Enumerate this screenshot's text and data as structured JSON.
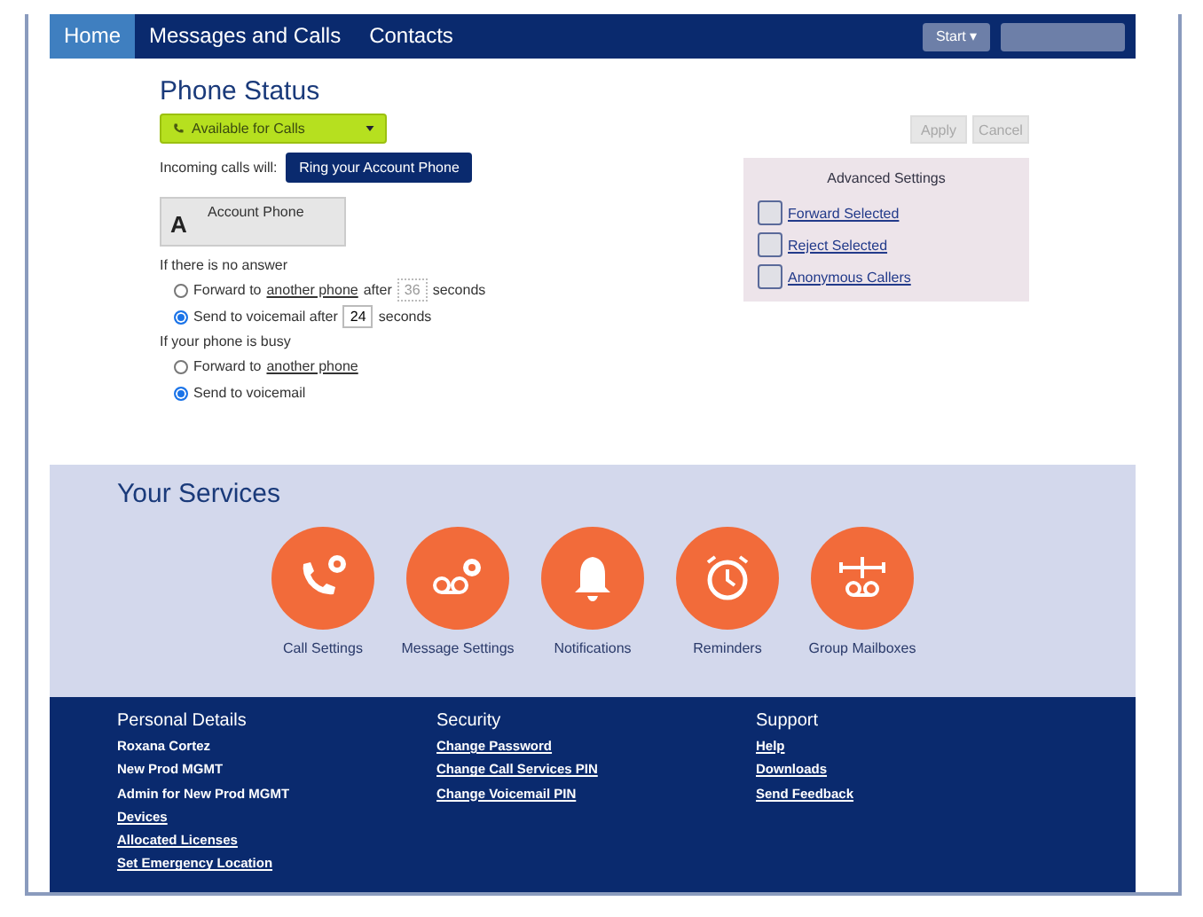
{
  "nav": {
    "tabs": [
      {
        "label": "Home",
        "selected": true
      },
      {
        "label": "Messages and Calls",
        "selected": false
      },
      {
        "label": "Contacts",
        "selected": false
      }
    ],
    "start": "Start ▾"
  },
  "phone_status": {
    "title": "Phone Status",
    "status": "Available for Calls",
    "incoming_label": "Incoming calls will:",
    "incoming_action": "Ring your Account Phone",
    "device_letter": "A",
    "device_name": "Account Phone",
    "groups": [
      {
        "heading": "If there is no answer",
        "options": [
          {
            "selected": false,
            "text": "Forward to",
            "link": "another phone",
            "after": "after",
            "seconds": "36",
            "unit": "seconds"
          },
          {
            "selected": true,
            "text": "Send to voicemail after",
            "seconds": "24",
            "unit": "seconds"
          }
        ]
      },
      {
        "heading": "If your phone is busy",
        "options": [
          {
            "selected": false,
            "text": "Forward to",
            "link": "another phone"
          },
          {
            "selected": true,
            "text": "Send to voicemail"
          }
        ]
      }
    ],
    "buttons": [
      "Apply",
      "Cancel"
    ],
    "advanced": {
      "title": "Advanced Settings",
      "items": [
        {
          "label": "Forward Selected",
          "checked": false
        },
        {
          "label": "Reject Selected",
          "checked": false
        },
        {
          "label": "Anonymous Callers",
          "checked": false
        }
      ]
    }
  },
  "services": {
    "title": "Your Services",
    "items": [
      {
        "kind": "call-settings",
        "label": "Call Settings"
      },
      {
        "kind": "message-settings",
        "label": "Message Settings"
      },
      {
        "kind": "notifications",
        "label": "Notifications"
      },
      {
        "kind": "reminders",
        "label": "Reminders"
      },
      {
        "kind": "group-mailboxes",
        "label": "Group Mailboxes"
      }
    ]
  },
  "footer": [
    {
      "title": "Personal Details",
      "items": [
        {
          "text": "Roxana Cortez",
          "link": false
        },
        {
          "text": "New Prod MGMT",
          "link": false
        },
        {
          "text": "Admin for New Prod MGMT",
          "link": false
        },
        {
          "text": "Devices",
          "link": true
        },
        {
          "text": "Allocated Licenses",
          "link": true
        },
        {
          "text": "Set Emergency Location",
          "link": true
        }
      ]
    },
    {
      "title": "Security",
      "items": [
        {
          "text": "Change Password",
          "link": true
        },
        {
          "text": "Change Call Services PIN",
          "link": true
        },
        {
          "text": "Change Voicemail PIN",
          "link": true
        }
      ]
    },
    {
      "title": "Support",
      "items": [
        {
          "text": "Help",
          "link": true
        },
        {
          "text": "Downloads",
          "link": true
        },
        {
          "text": "Send Feedback",
          "link": true
        }
      ]
    }
  ]
}
